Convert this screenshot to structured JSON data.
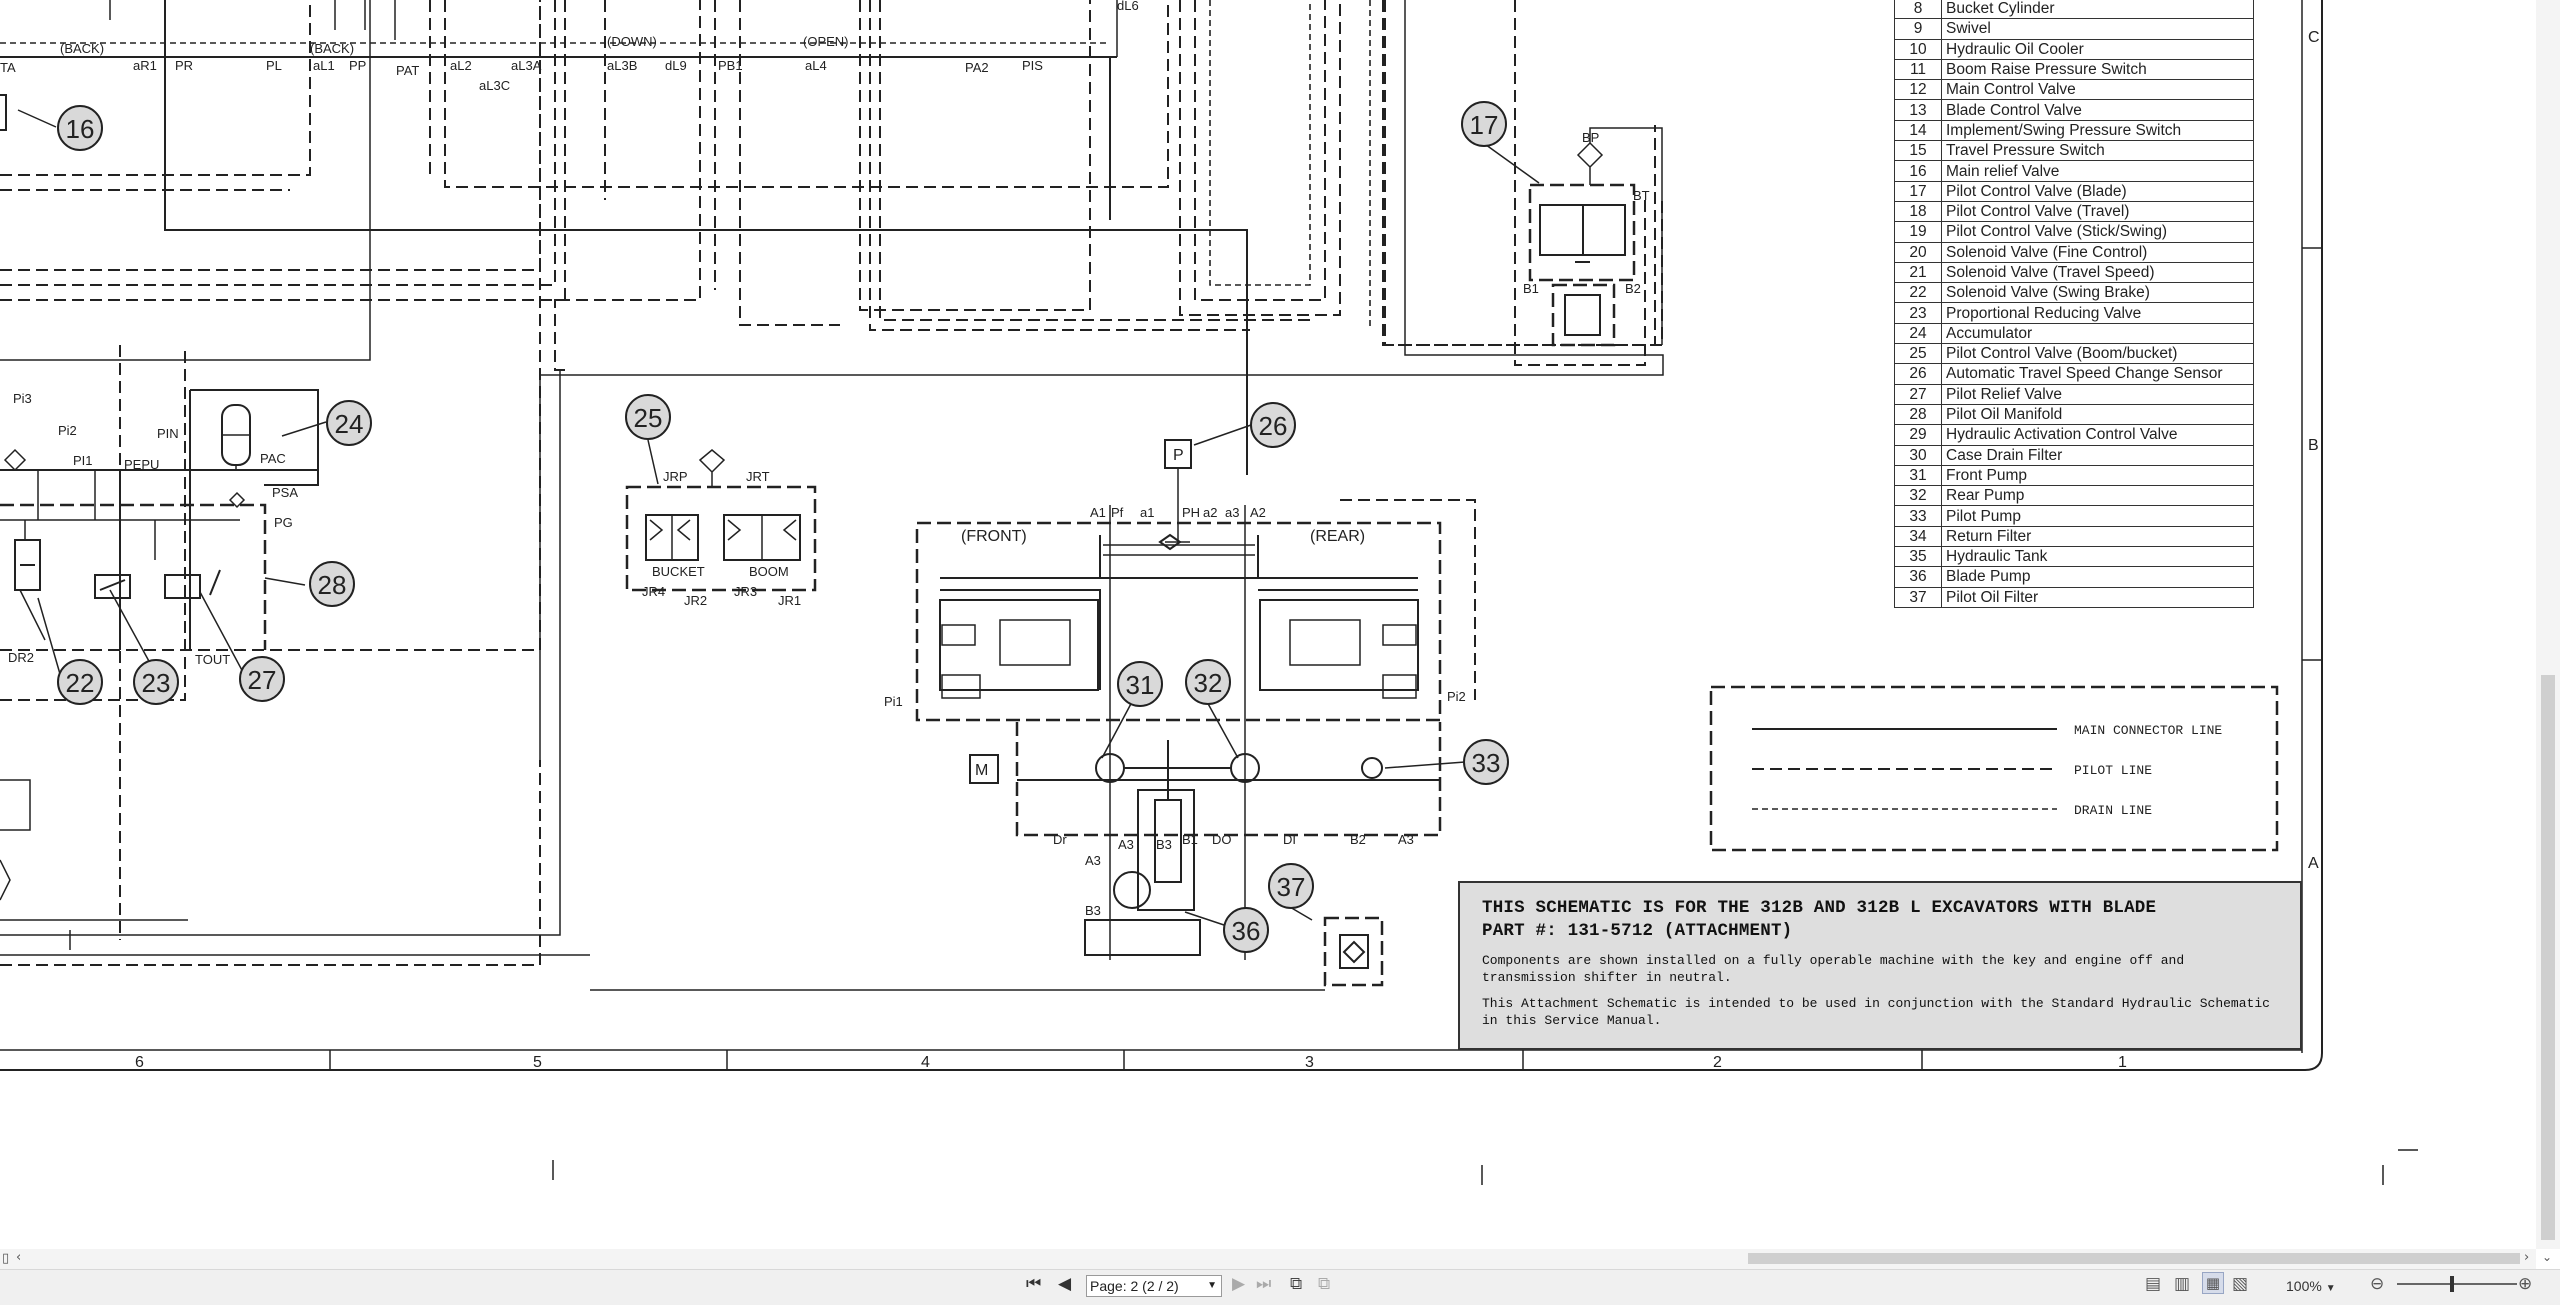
{
  "parts_table": [
    {
      "num": "8",
      "name": "Bucket Cylinder"
    },
    {
      "num": "9",
      "name": "Swivel"
    },
    {
      "num": "10",
      "name": "Hydraulic Oil Cooler"
    },
    {
      "num": "11",
      "name": "Boom Raise Pressure Switch"
    },
    {
      "num": "12",
      "name": "Main Control Valve"
    },
    {
      "num": "13",
      "name": "Blade Control Valve"
    },
    {
      "num": "14",
      "name": "Implement/Swing Pressure Switch"
    },
    {
      "num": "15",
      "name": "Travel Pressure Switch"
    },
    {
      "num": "16",
      "name": "Main relief Valve"
    },
    {
      "num": "17",
      "name": "Pilot Control Valve (Blade)"
    },
    {
      "num": "18",
      "name": "Pilot Control Valve (Travel)"
    },
    {
      "num": "19",
      "name": "Pilot Control Valve (Stick/Swing)"
    },
    {
      "num": "20",
      "name": "Solenoid Valve (Fine Control)"
    },
    {
      "num": "21",
      "name": "Solenoid Valve (Travel Speed)"
    },
    {
      "num": "22",
      "name": "Solenoid Valve (Swing Brake)"
    },
    {
      "num": "23",
      "name": "Proportional Reducing Valve"
    },
    {
      "num": "24",
      "name": "Accumulator"
    },
    {
      "num": "25",
      "name": "Pilot Control Valve (Boom/bucket)"
    },
    {
      "num": "26",
      "name": "Automatic Travel Speed Change Sensor"
    },
    {
      "num": "27",
      "name": "Pilot Relief Valve"
    },
    {
      "num": "28",
      "name": "Pilot Oil Manifold"
    },
    {
      "num": "29",
      "name": "Hydraulic Activation Control Valve"
    },
    {
      "num": "30",
      "name": "Case Drain Filter"
    },
    {
      "num": "31",
      "name": "Front Pump"
    },
    {
      "num": "32",
      "name": "Rear Pump"
    },
    {
      "num": "33",
      "name": "Pilot Pump"
    },
    {
      "num": "34",
      "name": "Return Filter"
    },
    {
      "num": "35",
      "name": "Hydraulic Tank"
    },
    {
      "num": "36",
      "name": "Blade Pump"
    },
    {
      "num": "37",
      "name": "Pilot Oil Filter"
    }
  ],
  "legend": {
    "main": "MAIN CONNECTOR LINE",
    "pilot": "PILOT LINE",
    "drain": "DRAIN LINE"
  },
  "note": {
    "title_line1": "THIS SCHEMATIC IS FOR THE 312B AND 312B L EXCAVATORS WITH BLADE",
    "title_line2": "PART #: 131-5712 (ATTACHMENT)",
    "para1": "Components are shown installed on a fully operable machine with the key and engine off and transmission shifter in neutral.",
    "para2": "This Attachment Schematic is intended to be used in conjunction with the Standard Hydraulic Schematic in this Service Manual."
  },
  "zones": {
    "bottom": [
      "6",
      "5",
      "4",
      "3",
      "2",
      "1"
    ],
    "right": [
      "C",
      "B",
      "A"
    ]
  },
  "balloons": [
    "16",
    "17",
    "24",
    "25",
    "26",
    "28",
    "22",
    "23",
    "27",
    "31",
    "32",
    "33",
    "37",
    "36"
  ],
  "labels": {
    "back1": "(BACK)",
    "back2": "(BACK)",
    "down": "(DOWN)",
    "open": "(OPEN)",
    "ta": "TA",
    "ar1": "aR1",
    "pr": "PR",
    "pl": "PL",
    "al1": "aL1",
    "pp": "PP",
    "pat": "PAT",
    "al2": "aL2",
    "al3a": "aL3A",
    "al3c": "aL3C",
    "al3b": "aL3B",
    "dl9": "dL9",
    "pb1": "PB1",
    "al4": "aL4",
    "pa2": "PA2",
    "pis": "PIS",
    "dl6": "dL6",
    "pi3": "Pi3",
    "pi2": "Pi2",
    "pin": "PIN",
    "pi1l": "PI1",
    "pepu": "PEPU",
    "pac": "PAC",
    "psa": "PSA",
    "pg": "PG",
    "dr2": "DR2",
    "tout": "TOUT",
    "jrp": "JRP",
    "jrt": "JRT",
    "bucket": "BUCKET",
    "boom": "BOOM",
    "jr4": "JR4",
    "jr2": "JR2",
    "jr3": "JR3",
    "jr1": "JR1",
    "p": "P",
    "a1": "A1",
    "pf": "Pf",
    "a1s": "a1",
    "ph": "PH",
    "a2s": "a2",
    "a3s": "a3",
    "a2": "A2",
    "front": "(FRONT)",
    "rear": "(REAR)",
    "pi1": "Pi1",
    "pi2r": "Pi2",
    "m": "M",
    "dr": "Dr",
    "a3": "A3",
    "b3": "B3",
    "b1": "B1",
    "di": "DI",
    "b2": "B2",
    "a3r": "A3",
    "do": "DO",
    "a3l": "A3",
    "bs": "B3",
    "bp": "BP",
    "bt": "BT",
    "b1v": "B1",
    "b2v": "B2"
  },
  "viewer": {
    "page_field": "Page: 2 (2 / 2)",
    "zoom": "100%"
  }
}
